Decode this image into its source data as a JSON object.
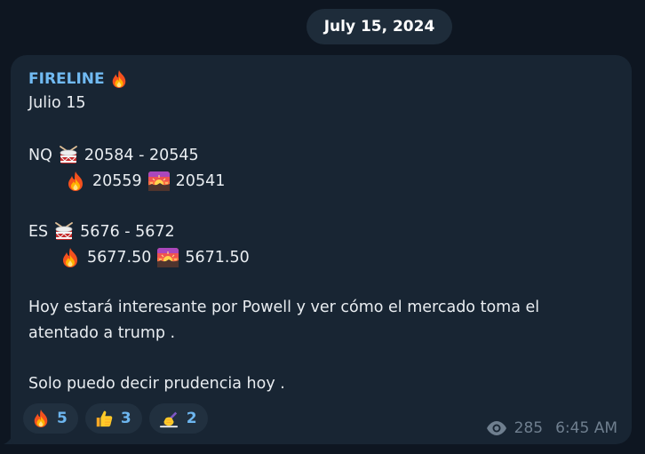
{
  "date_separator": "July 15, 2024",
  "message": {
    "sender": "FIRELINE",
    "lines": {
      "date_line": "Julio 15",
      "nq_label": "NQ",
      "nq_range": "20584 - 20545",
      "nq_up": "20559",
      "nq_down": "20541",
      "es_label": "ES",
      "es_range": "5676 - 5672",
      "es_up": "5677.50",
      "es_down": "5671.50",
      "para1_line1": "Hoy estará interesante por Powell y ver cómo el mercado toma el",
      "para1_line2": "atentado a trump .",
      "para2": "Solo puedo decir prudencia hoy ."
    },
    "reactions": [
      {
        "icon": "fire-icon",
        "count": "5"
      },
      {
        "icon": "thumbs-up-icon",
        "count": "3"
      },
      {
        "icon": "writing-hand-icon",
        "count": "2"
      }
    ],
    "views": "285",
    "time": "6:45 AM"
  },
  "colors": {
    "background": "#0e1621",
    "bubble": "#182533",
    "sender": "#71baf2",
    "reaction_count": "#6db6ef",
    "meta": "#6f7f8f"
  }
}
